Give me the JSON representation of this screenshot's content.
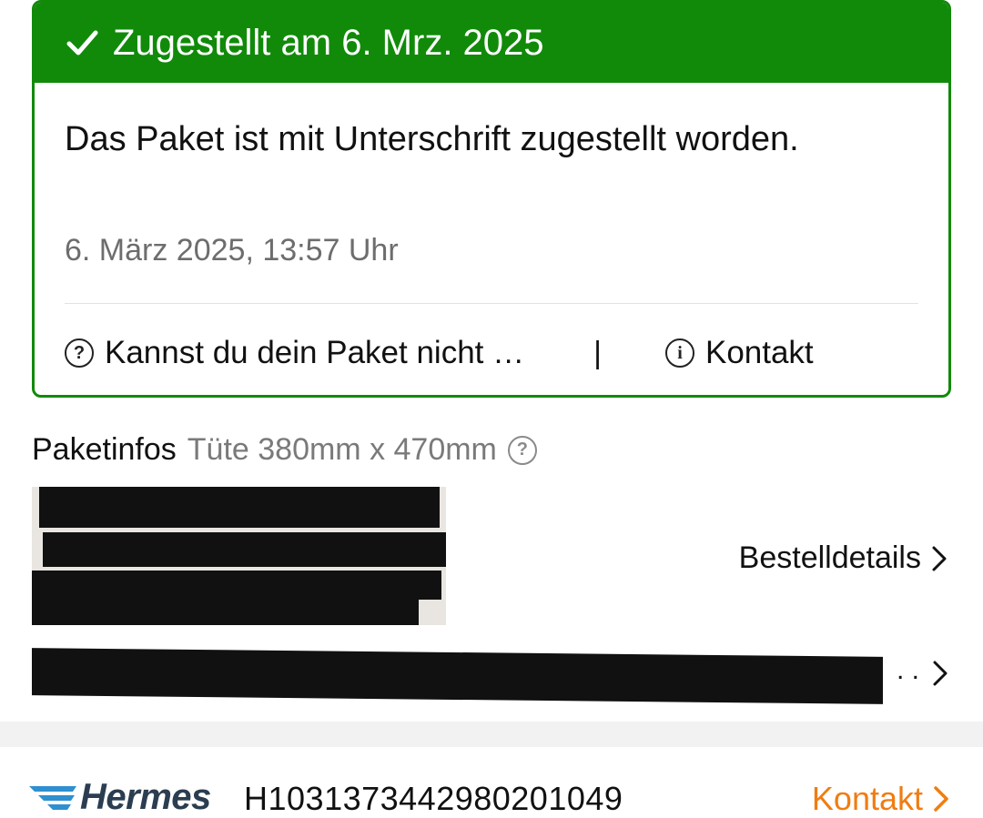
{
  "status_card": {
    "title": "Zugestellt am 6. Mrz. 2025",
    "message": "Das Paket ist mit Unterschrift zugestellt worden.",
    "timestamp": "6. März 2025, 13:57 Uhr",
    "faq_link": "Kannst du dein Paket nicht …",
    "separator": "|",
    "contact_link": "Kontakt",
    "accent_color": "#118a0a"
  },
  "package_info": {
    "label": "Paketinfos",
    "size": "Tüte 380mm x 470mm"
  },
  "order": {
    "details_link": "Bestelldetails"
  },
  "address_row": {
    "ellipsis": ". ."
  },
  "carrier": {
    "name": "Hermes",
    "tracking_number": "H1031373442980201049",
    "contact_link": "Kontakt",
    "link_color": "#f07d12"
  },
  "icons": [
    "checkmark-icon",
    "question-circle-icon",
    "info-circle-icon",
    "chevron-right-icon",
    "hermes-logo-icon"
  ]
}
